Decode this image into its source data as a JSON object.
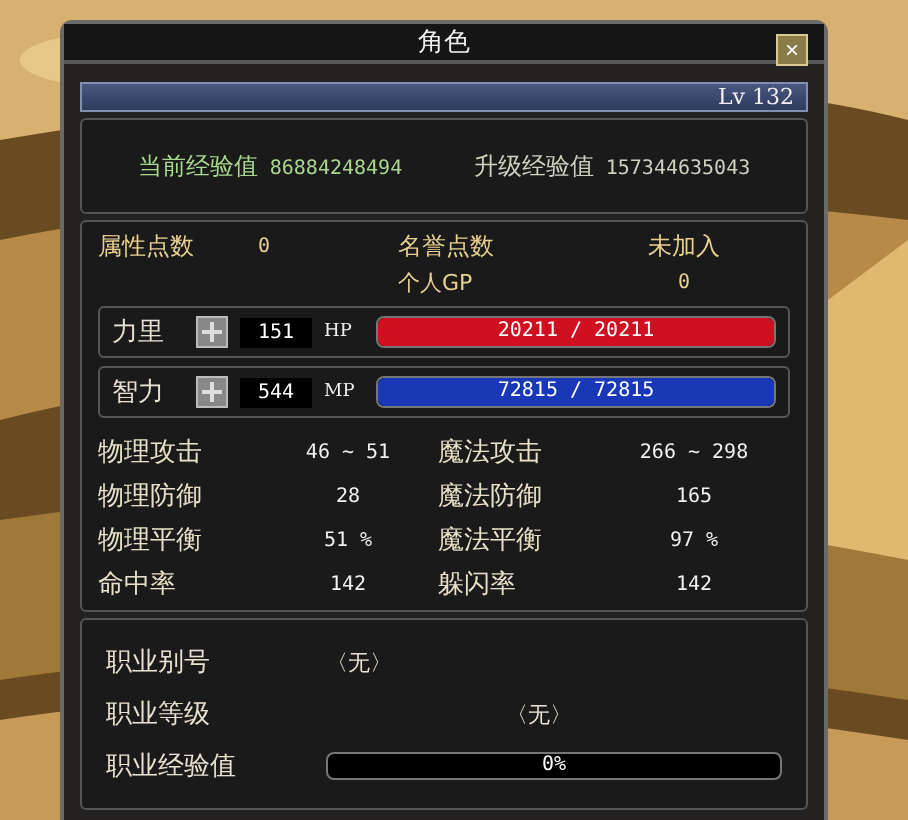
{
  "window": {
    "title": "角色",
    "close": "×"
  },
  "character": {
    "level": "Lv 132"
  },
  "experience": [
    {
      "label": "当前经验值",
      "value": "86884248494"
    },
    {
      "label": "升级经验值",
      "value": "157344635043"
    }
  ],
  "points": {
    "label": "属性点数",
    "value": "0"
  },
  "honor": {
    "label": "名誉点数",
    "status": "未加入",
    "gp_label": "个人GP",
    "gp_value": "0"
  },
  "attributes": [
    {
      "label": "力里",
      "value": "151",
      "bar_label": "HP",
      "reading": "20211 / 20211",
      "level": 1,
      "color": "#d01020"
    },
    {
      "label": "智力",
      "value": "544",
      "bar_label": "MP",
      "reading": "72815 / 72815",
      "level": 1,
      "color": "#1838b8"
    }
  ],
  "stats": [
    {
      "label": "物理攻击",
      "value": "46 ~ 51"
    },
    {
      "label": "魔法攻击",
      "value": "266 ~ 298"
    },
    {
      "label": "物理防御",
      "value": "28"
    },
    {
      "label": "魔法防御",
      "value": "165"
    },
    {
      "label": "物理平衡",
      "value": "51 %"
    },
    {
      "label": "魔法平衡",
      "value": "97 %"
    },
    {
      "label": "命中率",
      "value": "142"
    },
    {
      "label": "躲闪率",
      "value": "142"
    }
  ],
  "job": {
    "title_label": "职业别号",
    "title_value": "〈无〉",
    "grade_label": "职业等级",
    "grade_value": "〈无〉",
    "exp_label": "职业经验值",
    "exp_reading": "0%"
  }
}
